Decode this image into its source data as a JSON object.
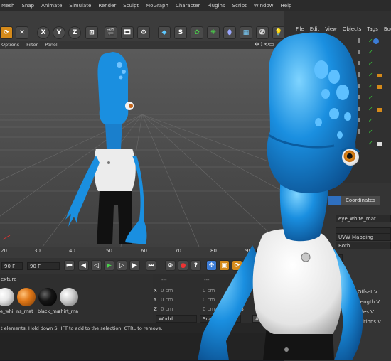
{
  "menubar": {
    "items": [
      "Mesh",
      "Snap",
      "Animate",
      "Simulate",
      "Render",
      "Sculpt",
      "MoGraph",
      "Character",
      "Plugins",
      "Script",
      "Window",
      "Help"
    ]
  },
  "toolbar": {
    "axis_x": "X",
    "axis_y": "Y",
    "axis_z": "Z"
  },
  "viewport_menu": {
    "items": [
      "Options",
      "Filter",
      "Panel"
    ]
  },
  "object_manager": {
    "menu": [
      "File",
      "Edit",
      "View",
      "Objects",
      "Tags",
      "Bookm"
    ]
  },
  "timeline": {
    "ticks": [
      "20",
      "30",
      "40",
      "50",
      "60",
      "70",
      "80",
      "90"
    ],
    "current_frame": "0 F"
  },
  "transport": {
    "start_field": "90 F",
    "end_field": "90 F"
  },
  "material_manager": {
    "tab_label": "exture",
    "materials": [
      {
        "label": "e_whi",
        "color": "#e6e6e6"
      },
      {
        "label": "ns_mat",
        "color": "#e07818"
      },
      {
        "label": "black_ma",
        "color": "#151515"
      },
      {
        "label": "shirt_ma",
        "color": "#cfcfcf"
      }
    ]
  },
  "coordinates": {
    "headers": [
      "---",
      "---",
      "---"
    ],
    "rows": [
      {
        "axis": "X",
        "value": "0 cm",
        "value2": "0 cm",
        "label3": "H"
      },
      {
        "axis": "Y",
        "value": "0 cm",
        "value2": "0 cm",
        "label3": "P"
      },
      {
        "axis": "Z",
        "value": "0 cm",
        "value2": "0 cm",
        "label3": "B"
      }
    ],
    "dropdown_world": "World",
    "dropdown_scale": "Scale",
    "apply_label": "A"
  },
  "status": {
    "text": "t elements. Hold down SHIFT to add to the selection, CTRL to remove."
  },
  "attributes": {
    "tab_coordinates": "Coordinates",
    "material_name": "eye_white_mat",
    "projection": "UVW Mapping",
    "side": "Both",
    "row_label_s": "S",
    "offset_label": "Offset V",
    "length_label": "Length V",
    "tiles_label": "Tiles V",
    "reps_label": "etitions V",
    "percent_a": "%",
    "percent_b": "%"
  },
  "colors": {
    "character_blue": "#1a8fe0",
    "eye_orange": "#e08a1a",
    "check_green": "#39c939"
  }
}
